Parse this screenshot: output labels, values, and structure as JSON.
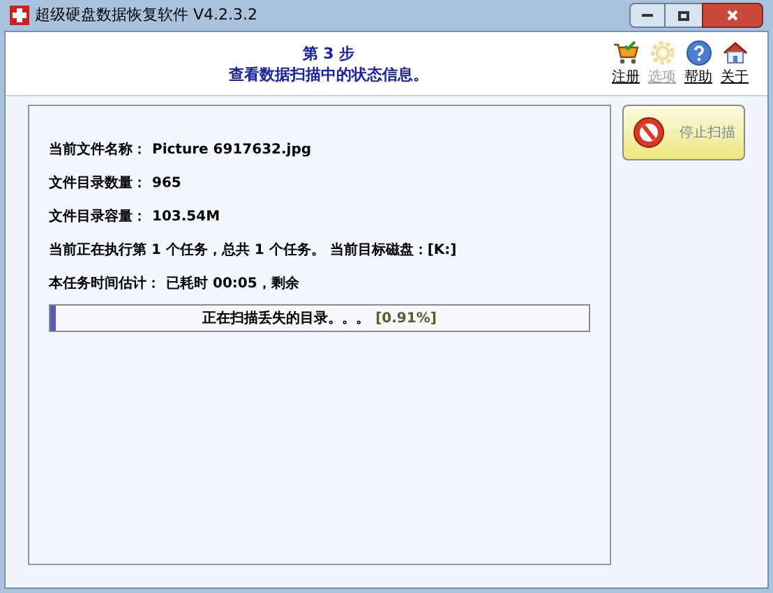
{
  "window": {
    "title": "超级硬盘数据恢复软件 V4.2.3.2"
  },
  "header": {
    "step": "第 3 步",
    "subtitle": "查看数据扫描中的状态信息。"
  },
  "toolbar": [
    {
      "kind": "cart",
      "label": "注册",
      "disabled": false
    },
    {
      "kind": "gear",
      "label": "选项",
      "disabled": true
    },
    {
      "kind": "help",
      "label": "帮助",
      "disabled": false
    },
    {
      "kind": "home",
      "label": "关于",
      "disabled": false
    }
  ],
  "info": [
    {
      "label": "当前文件名称：",
      "value": "Picture 6917632.jpg"
    },
    {
      "label": "文件目录数量：",
      "value": "965"
    },
    {
      "label": "文件目录容量：",
      "value": "103.54M"
    },
    {
      "label": "当前正在执行第 1 个任务，总共 1 个任务。 当前目标磁盘：[K:]"
    },
    {
      "label": "本任务时间估计：",
      "value": "已耗时 00:05，剩余"
    }
  ],
  "progress": {
    "text": "正在扫描丢失的目录。。。",
    "percent": "[0.91%]",
    "level": 0.0091
  },
  "stop_button": {
    "label": "停止扫描"
  }
}
